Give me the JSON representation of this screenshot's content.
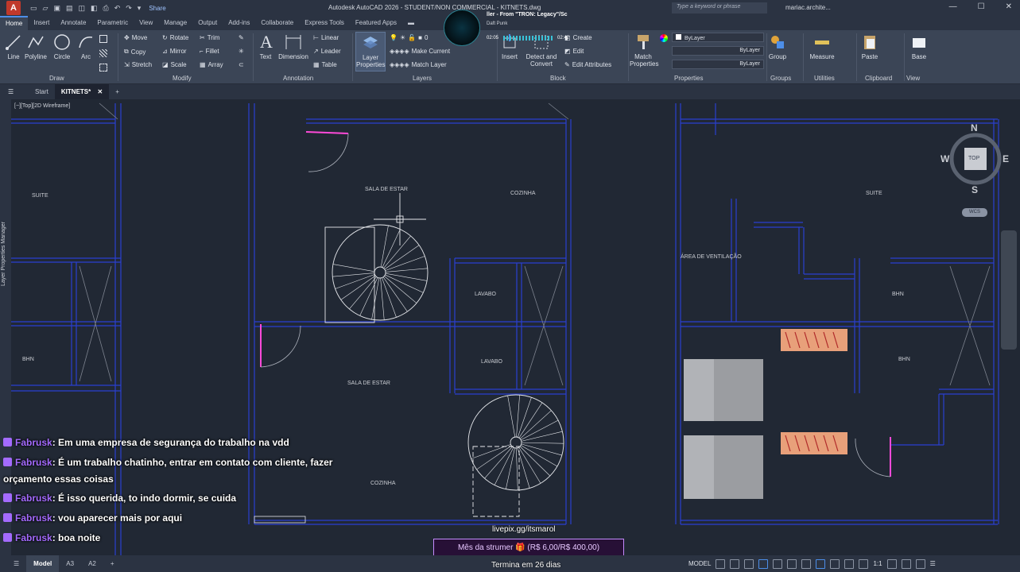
{
  "titlebar": {
    "logo": "A",
    "share": "Share",
    "title": "Autodesk AutoCAD 2026 - STUDENT/NON COMMERCIAL - KITNETS.dwg",
    "search_placeholder": "Type a keyword or phrase",
    "user": "mariac.archite...",
    "min": "—",
    "max": "☐",
    "close": "✕"
  },
  "music": {
    "title": "ller - From \"TRON: Legacy\"/Sc",
    "artist": "Daft Punk",
    "elapsed": "02:05",
    "total": "02:42"
  },
  "tabs": [
    "Home",
    "Insert",
    "Annotate",
    "Parametric",
    "View",
    "Manage",
    "Output",
    "Add-ins",
    "Collaborate",
    "Express Tools",
    "Featured Apps"
  ],
  "ribbon": {
    "draw": {
      "line": "Line",
      "polyline": "Polyline",
      "circle": "Circle",
      "arc": "Arc",
      "title": "Draw"
    },
    "modify": {
      "move": "Move",
      "rotate": "Rotate",
      "trim": "Trim",
      "copy": "Copy",
      "mirror": "Mirror",
      "fillet": "Fillet",
      "stretch": "Stretch",
      "scale": "Scale",
      "array": "Array",
      "title": "Modify"
    },
    "annotation": {
      "text": "Text",
      "dimension": "Dimension",
      "linear": "Linear",
      "leader": "Leader",
      "table": "Table",
      "title": "Annotation"
    },
    "layers": {
      "layer_properties_1": "Layer",
      "layer_properties_2": "Properties",
      "make_current": "Make Current",
      "match_layer": "Match Layer",
      "layer_value": "0",
      "title": "Layers"
    },
    "block": {
      "insert": "Insert",
      "create": "Create",
      "edit": "Edit",
      "detect_1": "Detect and",
      "detect_2": "Convert",
      "edit_attributes": "Edit Attributes",
      "title": "Block"
    },
    "properties": {
      "match_1": "Match",
      "match_2": "Properties",
      "color": "ByLayer",
      "linetype": "ByLayer",
      "lineweight": "ByLayer",
      "title": "Properties"
    },
    "groups": {
      "group": "Group",
      "title": "Groups"
    },
    "utilities": {
      "measure": "Measure",
      "title": "Utilities"
    },
    "clipboard": {
      "paste": "Paste",
      "title": "Clipboard"
    },
    "view": {
      "base": "Base",
      "title": "View"
    }
  },
  "filetabs": {
    "start": "Start",
    "current": "KITNETS*",
    "close": "✕",
    "add": "+"
  },
  "viewport_label": "[−][Top][2D Wireframe]",
  "layer_manager_label": "Layer Properties Manager",
  "viewcube": {
    "n": "N",
    "s": "S",
    "e": "E",
    "w": "W",
    "face": "TOP",
    "wcs": "WCS"
  },
  "rooms": {
    "suite_left": "SUITE",
    "bhn_left": "BHN",
    "sala_top": "SALA DE ESTAR",
    "cozinha_top": "COZINHA",
    "lavabo_top": "LAVABO",
    "lavabo_mid": "LAVABO",
    "sala_bottom": "SALA DE ESTAR",
    "cozinha_bottom": "COZINHA",
    "suite_right": "SUITE",
    "area_ventilacao": "ÁREA DE VENTILAÇÃO",
    "bhn_right_top": "BHN",
    "bhn_right_mid": "BHN"
  },
  "chat": [
    {
      "name": "Fabrusk",
      "text": ": Em uma empresa de segurança do trabalho na vdd"
    },
    {
      "name": "Fabrusk",
      "text": ": É um trabalho chatinho, entrar em contato com cliente, fazer"
    },
    {
      "name": "",
      "text": "orçamento essas coisas"
    },
    {
      "name": "Fabrusk",
      "text": ": É isso querida, to indo dormir, se cuida"
    },
    {
      "name": "Fabrusk",
      "text": ": vou aparecer mais por aqui"
    },
    {
      "name": "Fabrusk",
      "text": ": boa noite"
    }
  ],
  "overlay": {
    "livepix": "livepix.gg/itsmarol",
    "goal": "Mês da strumer 🎁 (R$ 6,00/R$ 400,00)",
    "ends": "Termina em 26 dias"
  },
  "statusbar": {
    "model_tab": "Model",
    "layout1": "A3",
    "layout2": "A2",
    "add": "+",
    "model_label": "MODEL",
    "scale": "1:1"
  },
  "colors": {
    "wall": "#2b3fd0",
    "magenta": "#ff4ad9",
    "accent": "#4d8ee8",
    "chat_name": "#a46bff"
  }
}
